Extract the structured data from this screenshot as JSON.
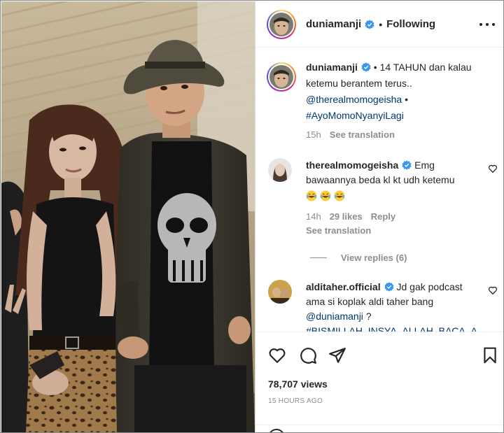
{
  "post": {
    "username": "duniamanji",
    "follow_state": "Following",
    "views": "78,707 views",
    "time_ago": "15 HOURS AGO"
  },
  "caption": {
    "username": "duniamanji",
    "text": "• 14 TAHUN dan kalau ketemu berantem terus..",
    "mention": "@therealmomogeisha",
    "sep": "•",
    "hashtag": "#AyoMomoNyanyiLagi",
    "time": "15h",
    "see_translation": "See translation"
  },
  "comments": [
    {
      "username": "therealmomogeisha",
      "text": "Emg bawaannya beda kl kt udh ketemu",
      "emojis": [
        "laughing-emoji",
        "laughing-emoji",
        "laughing-emoji"
      ],
      "time": "14h",
      "likes": "29 likes",
      "reply": "Reply",
      "see_translation": "See translation",
      "view_replies": "View replies (6)"
    },
    {
      "username": "alditaher.official",
      "text": "Jd gak podcast ama si koplak aldi taher bang",
      "mention": "@duniamanji",
      "trail": " ?",
      "hashtag": "#BISMILLAH_INSYA_ALLAH_BACA_A"
    }
  ],
  "icons": {
    "more": "more-horizontal-icon",
    "verified": "verified-badge-icon",
    "like": "heart-icon",
    "comment": "comment-icon",
    "share": "share-icon",
    "save": "bookmark-icon",
    "emoji": "emoji-icon"
  },
  "colors": {
    "verified": "#3897f0",
    "link": "#00376b",
    "secondary_text": "#8e8e8e",
    "primary_text": "#262626"
  }
}
